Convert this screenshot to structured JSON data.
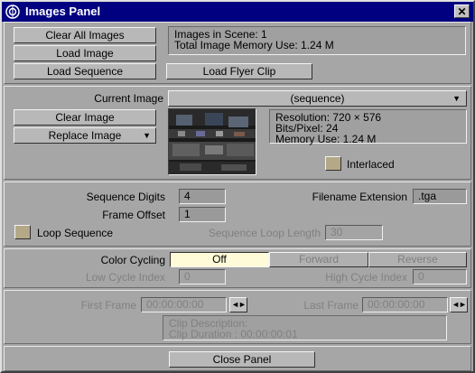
{
  "window": {
    "title": "Images Panel",
    "close_glyph": "✕"
  },
  "top": {
    "clear_all": "Clear All Images",
    "load_image": "Load Image",
    "load_sequence": "Load Sequence",
    "load_flyer": "Load Flyer Clip",
    "info_line1": "Images in Scene: 1",
    "info_line2": "Total Image Memory Use: 1.24 M"
  },
  "current": {
    "label": "Current Image",
    "value": "(sequence)",
    "clear_image": "Clear Image",
    "replace_image": "Replace Image",
    "resolution": "Resolution: 720 × 576",
    "bits": "Bits/Pixel: 24",
    "memory": "Memory Use: 1.24 M",
    "interlaced_label": "Interlaced",
    "interlaced_checked": false
  },
  "sequence": {
    "digits_label": "Sequence Digits",
    "digits_value": "4",
    "offset_label": "Frame Offset",
    "offset_value": "1",
    "ext_label": "Filename Extension",
    "ext_value": ".tga",
    "loop_label": "Loop Sequence",
    "loop_checked": false,
    "loop_length_label": "Sequence Loop Length",
    "loop_length_value": "30"
  },
  "cycling": {
    "label": "Color Cycling",
    "options": [
      "Off",
      "Forward",
      "Reverse"
    ],
    "selected": "Off",
    "low_label": "Low Cycle Index",
    "low_value": "0",
    "high_label": "High Cycle Index",
    "high_value": "0"
  },
  "clip": {
    "first_label": "First Frame",
    "first_value": "00:00:00:00",
    "last_label": "Last Frame",
    "last_value": "00:00:00:00",
    "desc_line1": "Clip Description:",
    "desc_line2": "Clip Duration : 00:00:00:01",
    "spin_glyph": "◄►"
  },
  "footer": {
    "close_panel": "Close Panel"
  },
  "colors": {
    "titlebar": "#000080",
    "panel": "#a6a6a6",
    "active_segment": "#fffbd8"
  }
}
